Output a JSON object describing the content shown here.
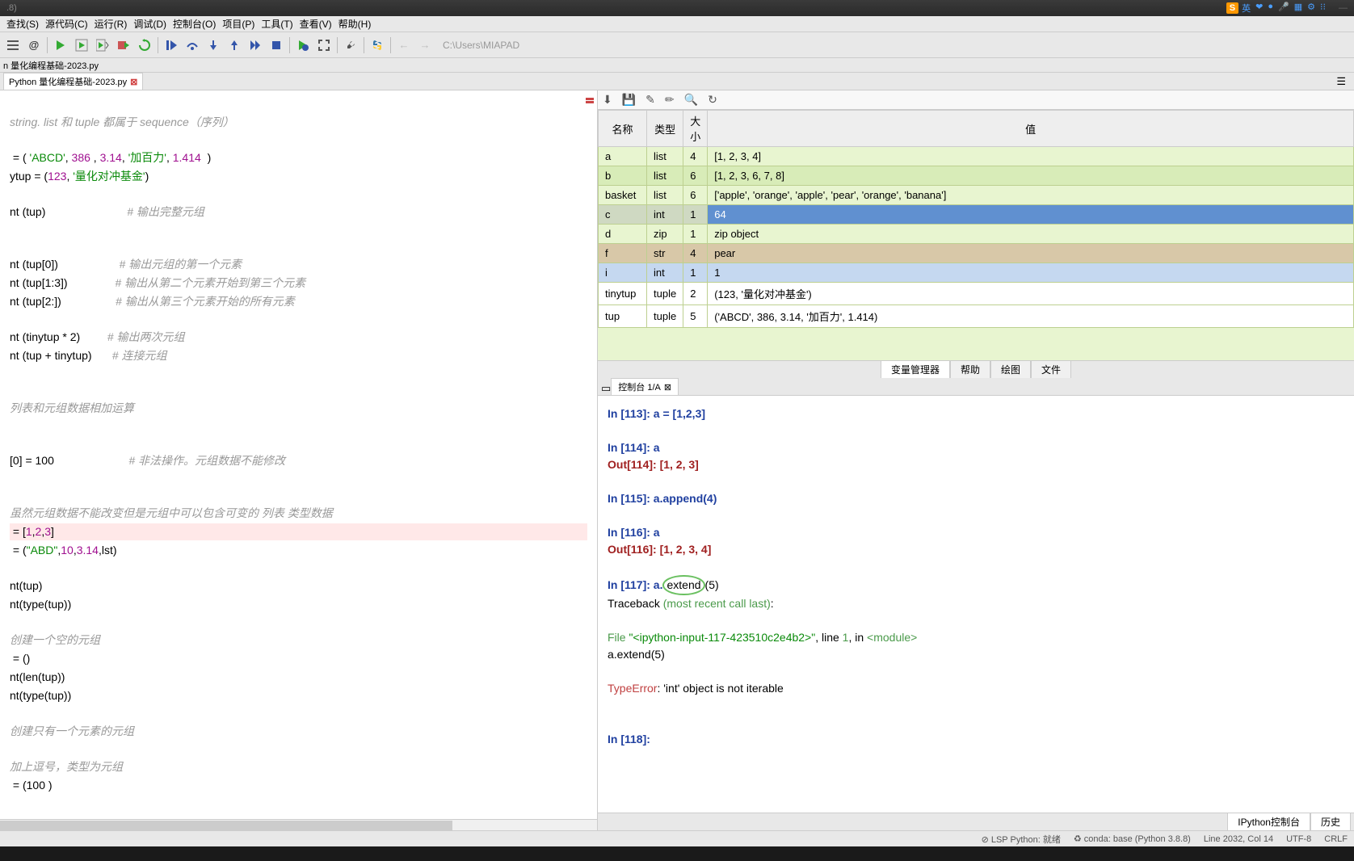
{
  "window": {
    "title": ".8)",
    "sogou": "S",
    "lang": "英"
  },
  "menu": {
    "search": "查找(S)",
    "source": "源代码(C)",
    "run": "运行(R)",
    "debug": "调试(D)",
    "console": "控制台(O)",
    "project": "项目(P)",
    "tools": "工具(T)",
    "view": "查看(V)",
    "help": "帮助(H)"
  },
  "toolbar": {
    "path": "C:\\Users\\MIAPAD"
  },
  "file_tab": "n 量化编程基础-2023.py",
  "editor_tab": "Python 量化编程基础-2023.py",
  "code": {
    "l1": "string. list 和 tuple 都属于 sequence（序列）",
    "l2a": " = ( ",
    "l2b": "'ABCD'",
    "l2c": ", ",
    "l2d": "386",
    "l2e": " , ",
    "l2f": "3.14",
    "l2g": ", ",
    "l2h": "'加百力'",
    "l2i": ", ",
    "l2j": "1.414",
    "l2k": "  )",
    "l3a": "ytup = (",
    "l3b": "123",
    "l3c": ", ",
    "l3d": "'量化对冲基金'",
    "l3e": ")",
    "l4": "nt (tup)",
    "l4c": "# 输出完整元组",
    "l5": "nt (tup[0])",
    "l5c": "# 输出元组的第一个元素",
    "l6": "nt (tup[1:3])",
    "l6c": "# 输出从第二个元素开始到第三个元素",
    "l7": "nt (tup[2:])",
    "l7c": "# 输出从第三个元素开始的所有元素",
    "l8": "nt (tinytup * 2)",
    "l8c": "# 输出两次元组",
    "l9": "nt (tup + tinytup)",
    "l9c": "# 连接元组",
    "l10": "列表和元组数据相加运算",
    "l11": "[0] = 100",
    "l11c": "# 非法操作。元组数据不能修改",
    "l12": "虽然元组数据不能改变但是元组中可以包含可变的 列表 类型数据",
    "l13a": " = [",
    "l13b": "1",
    "l13c": ",",
    "l13d": "2",
    "l13e": ",",
    "l13f": "3",
    "l13g": "]",
    "l14a": " = (",
    "l14b": "\"ABD\"",
    "l14c": ",",
    "l14d": "10",
    "l14e": ",",
    "l14f": "3.14",
    "l14g": ",lst)",
    "l15": "nt(tup)",
    "l16": "nt(type(tup))",
    "l17": "创建一个空的元组",
    "l18": " = ()",
    "l19": "nt(len(tup))",
    "l20": "nt(type(tup))",
    "l21": "创建只有一个元素的元组",
    "l22": "加上逗号，类型为元组",
    "l23": " = (100 )"
  },
  "var_headers": {
    "name": "名称",
    "type": "类型",
    "size": "大小",
    "value": "值"
  },
  "vars": [
    {
      "name": "a",
      "type": "list",
      "size": "4",
      "value": "[1, 2, 3, 4]"
    },
    {
      "name": "b",
      "type": "list",
      "size": "6",
      "value": "[1, 2, 3, 6, 7, 8]"
    },
    {
      "name": "basket",
      "type": "list",
      "size": "6",
      "value": "['apple', 'orange', 'apple', 'pear', 'orange', 'banana']"
    },
    {
      "name": "c",
      "type": "int",
      "size": "1",
      "value": "64"
    },
    {
      "name": "d",
      "type": "zip",
      "size": "1",
      "value": "zip object"
    },
    {
      "name": "f",
      "type": "str",
      "size": "4",
      "value": "pear"
    },
    {
      "name": "i",
      "type": "int",
      "size": "1",
      "value": "1"
    },
    {
      "name": "tinytup",
      "type": "tuple",
      "size": "2",
      "value": "(123, '量化对冲基金')"
    },
    {
      "name": "tup",
      "type": "tuple",
      "size": "5",
      "value": "('ABCD', 386, 3.14, '加百力', 1.414)"
    }
  ],
  "var_tabs": {
    "mgr": "变量管理器",
    "help": "帮助",
    "plot": "绘图",
    "file": "文件"
  },
  "console_tab": "控制台 1/A",
  "console": {
    "in113": "In [",
    "n113": "113",
    "in113b": "]: a = [1,2,3]",
    "in114": "In [",
    "n114": "114",
    "in114b": "]: a",
    "out114": "Out[",
    "out114b": "]: [1, 2, 3]",
    "in115": "In [",
    "n115": "115",
    "in115b": "]: a.append(4)",
    "in116": "In [",
    "n116": "116",
    "in116b": "]: a",
    "out116": "Out[",
    "out116b": "]: [1, 2, 3, 4]",
    "in117": "In [",
    "n117": "117",
    "in117b": "]: a.",
    "extend": "extend",
    "in117c": "(5)",
    "trace": "Traceback ",
    "trace2": "(most recent call last)",
    "trace3": ":",
    "file1": "  File ",
    "file2": "\"<ipython-input-117-423510c2e4b2>\"",
    "file3": ", line ",
    "file4": "1",
    "file5": ", in ",
    "file6": "<module>",
    "err_code": "    a.extend(5)",
    "err1": "TypeError",
    "err2": ": 'int' object is not iterable",
    "in118": "In [",
    "n118": "118",
    "in118b": "]: "
  },
  "console_bottom": {
    "ipython": "IPython控制台",
    "history": "历史"
  },
  "status": {
    "lsp": "⊘ LSP Python: 就绪",
    "conda": "♻ conda: base (Python 3.8.8)",
    "line": "Line 2032, Col 14",
    "enc": "UTF-8",
    "eol": "CRLF"
  }
}
